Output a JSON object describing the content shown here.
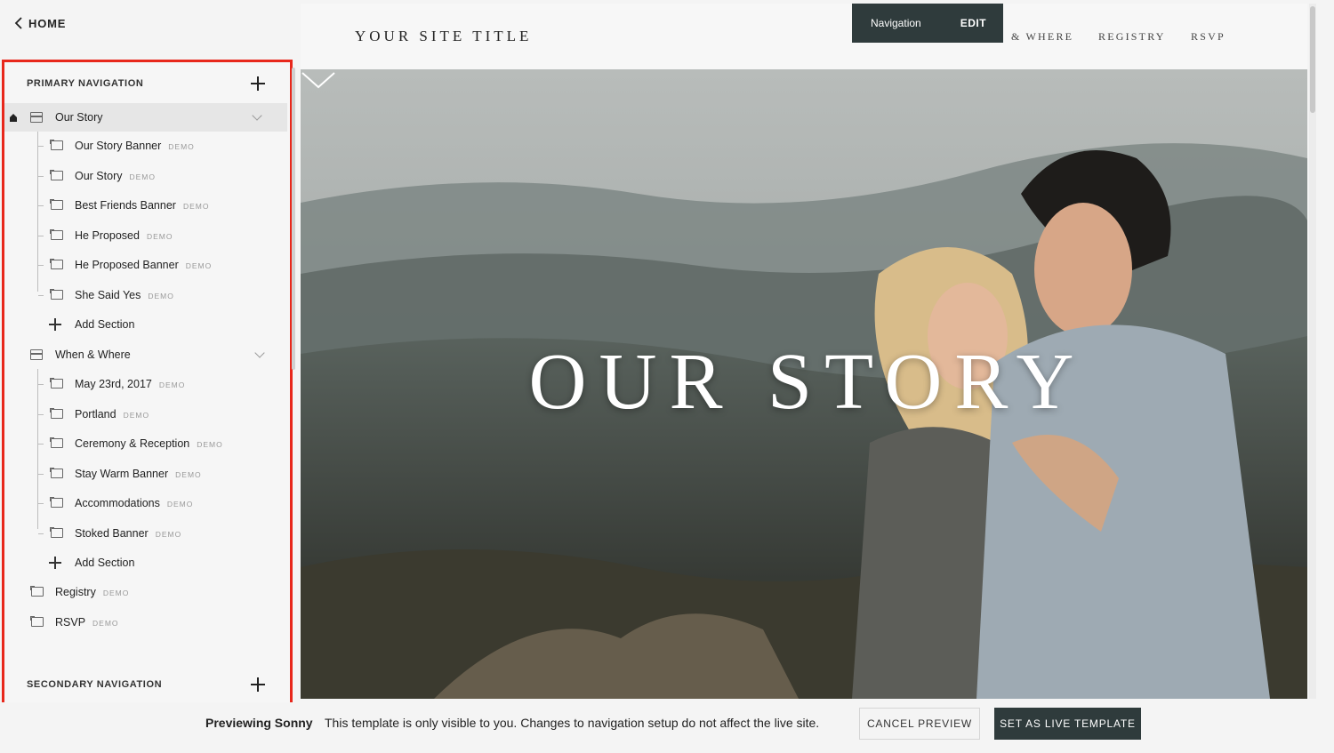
{
  "home_link": {
    "label": "HOME"
  },
  "primary_nav": {
    "title": "PRIMARY NAVIGATION",
    "demo_tag": "DEMO",
    "folders": [
      {
        "label": "Our Story",
        "sections": [
          "Our Story Banner",
          "Our Story",
          "Best Friends Banner",
          "He Proposed",
          "He Proposed Banner",
          "She Said Yes"
        ],
        "add_section_label": "Add Section"
      },
      {
        "label": "When & Where",
        "sections": [
          "May 23rd, 2017",
          "Portland",
          "Ceremony & Reception",
          "Stay Warm Banner",
          "Accommodations",
          "Stoked Banner"
        ],
        "add_section_label": "Add Section"
      }
    ],
    "pages": [
      "Registry",
      "RSVP"
    ]
  },
  "secondary_nav": {
    "title": "SECONDARY NAVIGATION"
  },
  "site": {
    "title": "YOUR SITE TITLE",
    "nav_items": [
      "& WHERE",
      "REGISTRY",
      "RSVP"
    ],
    "hero_title": "OUR STORY"
  },
  "edit_bar": {
    "label": "Navigation",
    "edit": "EDIT"
  },
  "bottom_bar": {
    "preview_label": "Previewing Sonny",
    "message": "This template is only visible to you. Changes to navigation setup do not affect the live site.",
    "cancel": "CANCEL PREVIEW",
    "set_live": "SET AS LIVE TEMPLATE"
  },
  "colors": {
    "highlight_border": "#e8281c",
    "dark_button": "#2f3b3c"
  }
}
